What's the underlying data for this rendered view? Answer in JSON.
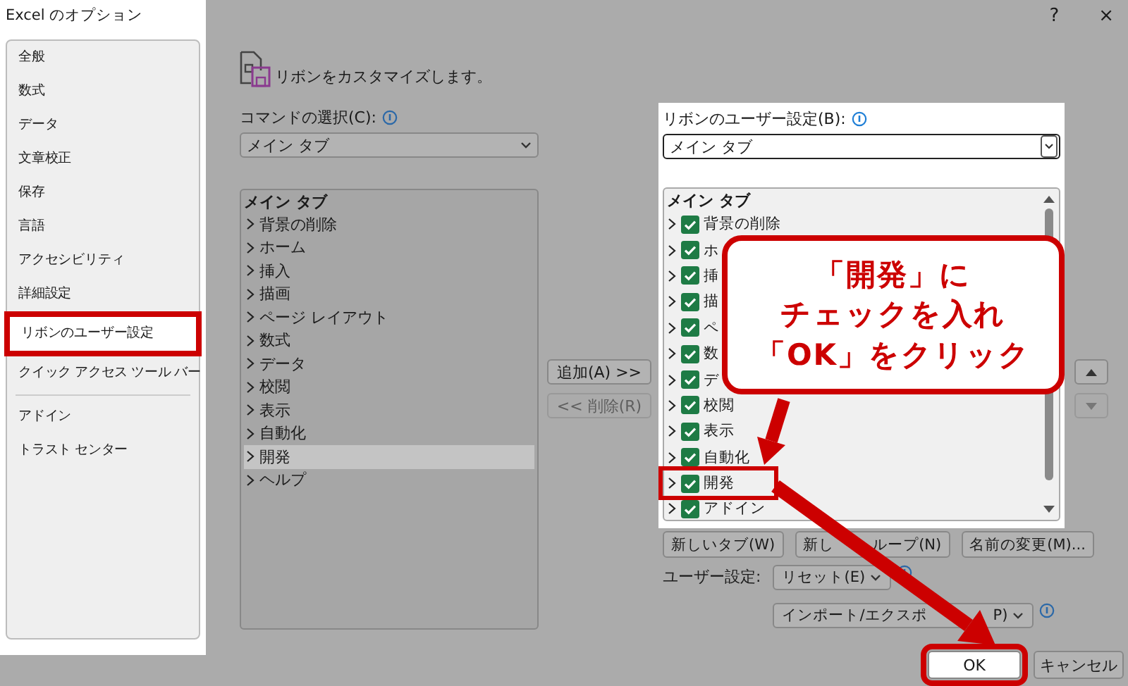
{
  "window": {
    "title": "Excel のオプション",
    "help": "?",
    "close": "×"
  },
  "sidebar": {
    "groups": [
      [
        {
          "label": "全般",
          "selected": false,
          "marked": false
        },
        {
          "label": "数式",
          "selected": false,
          "marked": false
        },
        {
          "label": "データ",
          "selected": false,
          "marked": false
        },
        {
          "label": "文章校正",
          "selected": false,
          "marked": false
        },
        {
          "label": "保存",
          "selected": false,
          "marked": false
        },
        {
          "label": "言語",
          "selected": false,
          "marked": false
        },
        {
          "label": "アクセシビリティ",
          "selected": false,
          "marked": false
        },
        {
          "label": "詳細設定",
          "selected": false,
          "marked": false
        },
        {
          "label": "リボンのユーザー設定",
          "selected": true,
          "marked": true
        },
        {
          "label": "クイック アクセス ツール バー",
          "selected": false,
          "marked": false
        }
      ],
      [
        {
          "label": "アドイン",
          "selected": false,
          "marked": false
        },
        {
          "label": "トラスト センター",
          "selected": false,
          "marked": false
        }
      ]
    ]
  },
  "header": "リボンをカスタマイズします。",
  "commands": {
    "label": "コマンドの選択(C):",
    "dropdown": "メイン タブ",
    "heading": "メイン タブ",
    "items": [
      {
        "label": "背景の削除",
        "selected": false
      },
      {
        "label": "ホーム",
        "selected": false
      },
      {
        "label": "挿入",
        "selected": false
      },
      {
        "label": "描画",
        "selected": false
      },
      {
        "label": "ページ レイアウト",
        "selected": false
      },
      {
        "label": "数式",
        "selected": false
      },
      {
        "label": "データ",
        "selected": false
      },
      {
        "label": "校閲",
        "selected": false
      },
      {
        "label": "表示",
        "selected": false
      },
      {
        "label": "自動化",
        "selected": false
      },
      {
        "label": "開発",
        "selected": true
      },
      {
        "label": "ヘルプ",
        "selected": false
      }
    ]
  },
  "move_buttons": [
    {
      "label": "追加(A) >>",
      "disabled": false
    },
    {
      "label": "<< 削除(R)",
      "disabled": true
    }
  ],
  "ribbon": {
    "label": "リボンのユーザー設定(B):",
    "dropdown": "メイン タブ",
    "heading": "メイン タブ",
    "items": [
      {
        "label": "背景の削除",
        "checked": true,
        "marked": false
      },
      {
        "label": "ホ",
        "checked": true,
        "marked": false
      },
      {
        "label": "挿",
        "checked": true,
        "marked": false
      },
      {
        "label": "描",
        "checked": true,
        "marked": false
      },
      {
        "label": "ペ",
        "checked": true,
        "marked": false
      },
      {
        "label": "数",
        "checked": true,
        "marked": false
      },
      {
        "label": "デ",
        "checked": true,
        "marked": false
      },
      {
        "label": "校閲",
        "checked": true,
        "marked": false
      },
      {
        "label": "表示",
        "checked": true,
        "marked": false
      },
      {
        "label": "自動化",
        "checked": true,
        "marked": false
      },
      {
        "label": "開発",
        "checked": true,
        "marked": true
      },
      {
        "label": "アドイン",
        "checked": true,
        "marked": false
      }
    ]
  },
  "order_buttons": [
    {
      "kind": "up",
      "disabled": false
    },
    {
      "kind": "down",
      "disabled": true
    }
  ],
  "tab_buttons": [
    {
      "parts": [
        "新しいタブ(W)"
      ]
    },
    {
      "parts": [
        "新し",
        "ループ(N)"
      ]
    },
    {
      "parts": [
        "名前の変更(M)..."
      ]
    }
  ],
  "customize": {
    "label": "ユーザー設定:",
    "buttons": [
      {
        "parts": [
          "リセット(E)"
        ]
      },
      {
        "parts": [
          "インポート/エクスポ",
          "P)"
        ]
      }
    ]
  },
  "dialog_buttons": [
    {
      "label": "OK",
      "marked": true
    },
    {
      "label": "キャンセル",
      "marked": false
    }
  ],
  "callout": {
    "lines": [
      "「開発」に",
      "チェックを入れ",
      "「OK」をクリック"
    ]
  }
}
